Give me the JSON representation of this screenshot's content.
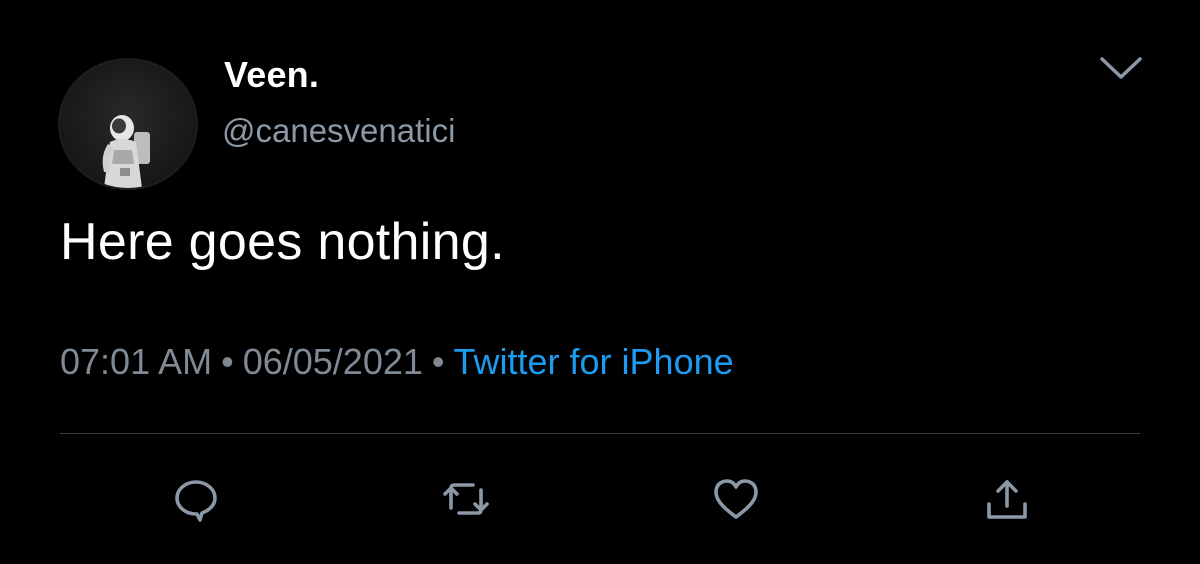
{
  "tweet": {
    "author": {
      "display_name": "Veen.",
      "handle": "@canesvenatici",
      "avatar_icon": "astronaut-avatar"
    },
    "text": "Here goes nothing.",
    "meta": {
      "time": "07:01 AM",
      "separator": "•",
      "date": "06/05/2021",
      "source": "Twitter for iPhone"
    },
    "actions": [
      {
        "icon": "reply-icon"
      },
      {
        "icon": "retweet-icon"
      },
      {
        "icon": "like-icon"
      },
      {
        "icon": "share-icon"
      }
    ]
  },
  "colors": {
    "background": "#000000",
    "text_primary": "#ffffff",
    "text_secondary": "#8b98a5",
    "link": "#1d9bf0",
    "icon": "#8b98a5",
    "divider": "#3a3d41"
  }
}
